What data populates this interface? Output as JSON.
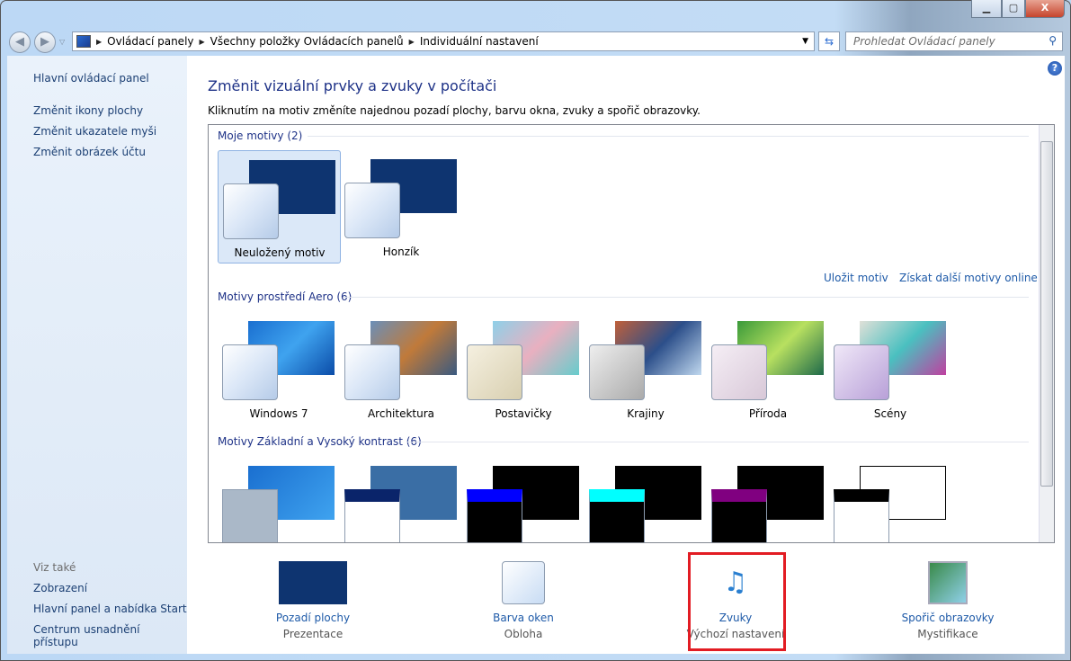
{
  "window": {
    "min": "▁",
    "max": "▢",
    "close": "X"
  },
  "address": {
    "parts": [
      "Ovládací panely",
      "Všechny položky Ovládacích panelů",
      "Individuální nastavení"
    ],
    "search_placeholder": "Prohledat Ovládací panely"
  },
  "sidebar": {
    "home": "Hlavní ovládací panel",
    "links": [
      "Změnit ikony plochy",
      "Změnit ukazatele myši",
      "Změnit obrázek účtu"
    ],
    "see_also": "Viz také",
    "also_links": [
      "Zobrazení",
      "Hlavní panel a nabídka Start",
      "Centrum usnadnění přístupu"
    ]
  },
  "main": {
    "title": "Změnit vizuální prvky a zvuky v počítači",
    "subtitle": "Kliknutím na motiv změníte najednou pozadí plochy, barvu okna, zvuky a spořič obrazovky.",
    "groups": [
      {
        "label": "Moje motivy (2)",
        "themes": [
          "Neuložený motiv",
          "Honzík"
        ]
      },
      {
        "label": "Motivy prostředí Aero (6)",
        "themes": [
          "Windows 7",
          "Architektura",
          "Postavičky",
          "Krajiny",
          "Příroda",
          "Scény"
        ]
      },
      {
        "label": "Motivy Základní a Vysoký kontrast (6)",
        "themes": []
      }
    ],
    "save_theme": "Uložit motiv",
    "more_themes": "Získat další motivy online"
  },
  "bottom": [
    {
      "title": "Pozadí plochy",
      "sub": "Prezentace"
    },
    {
      "title": "Barva oken",
      "sub": "Obloha"
    },
    {
      "title": "Zvuky",
      "sub": "Výchozí nastavení"
    },
    {
      "title": "Spořič obrazovky",
      "sub": "Mystifikace"
    }
  ],
  "colors": {
    "highlight": "#e21c23",
    "link": "#1e5aa8",
    "heading": "#1e3287"
  }
}
